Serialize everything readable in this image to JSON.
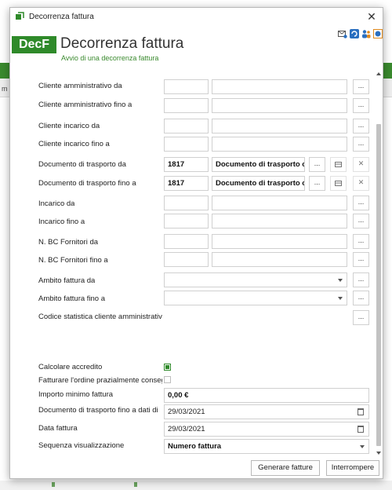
{
  "background": {
    "stray_text": "m"
  },
  "window": {
    "title": "Decorrenza fattura",
    "close": "✕"
  },
  "header": {
    "logo": "DecF",
    "title": "Decorrenza fattura",
    "subtitle": "Avvio di una decorrenza fattura"
  },
  "form": {
    "cliente_amm_da": "Cliente amministrativo da",
    "cliente_amm_fino": "Cliente amministrativo fino a",
    "cliente_inc_da": "Cliente incarico da",
    "cliente_inc_fino": "Cliente incarico fino a",
    "ddt_da": "Documento di trasporto da",
    "ddt_da_code": "1817",
    "ddt_da_desc": "Documento di trasporto c",
    "ddt_fino": "Documento di trasporto fino a",
    "ddt_fino_code": "1817",
    "ddt_fino_desc": "Documento di trasporto c",
    "incarico_da": "Incarico da",
    "incarico_fino": "Incarico fino a",
    "bc_da": "N. BC Fornitori da",
    "bc_fino": "N. BC Fornitori fino a",
    "ambito_da": "Ambito fattura da",
    "ambito_fino": "Ambito fattura fino a",
    "codice_stat": "Codice statistica cliente amministrativo",
    "calcolare": "Calcolare accredito",
    "calcolare_checked": true,
    "fatturare": "Fatturare l'ordine prazialmente consegnato",
    "fatturare_checked": false,
    "importo": "Importo minimo fattura",
    "importo_val": "0,00 €",
    "ddt_data": "Documento di trasporto fino a dati di",
    "ddt_data_val": "29/03/2021",
    "data_fattura": "Data fattura",
    "data_fattura_val": "29/03/2021",
    "sequenza": "Sequenza visualizzazione",
    "sequenza_val": "Numero fattura",
    "ellipsis": "...",
    "small_btn": "...",
    "clear_icon": "✕"
  },
  "buttons": {
    "generate": "Generare fatture",
    "cancel": "Interrompere"
  }
}
